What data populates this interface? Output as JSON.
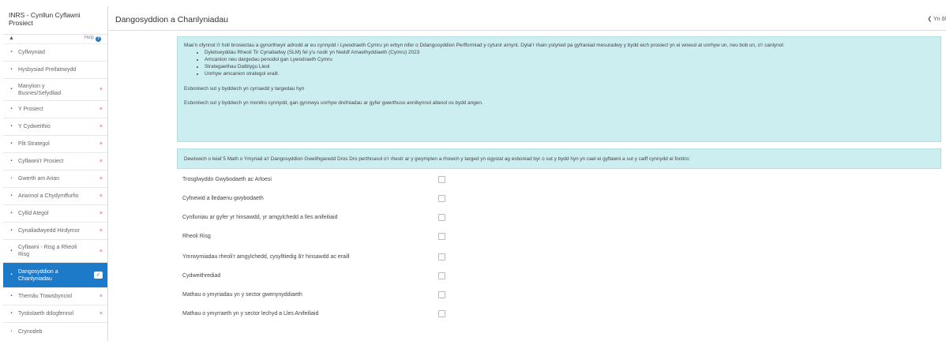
{
  "app": {
    "title_line1": "INRS - Cynllun Cyflawni",
    "title_line2": "Prosiect",
    "person_icon": "person-icon",
    "help_label": "Help"
  },
  "sidebar": {
    "items": [
      {
        "label": "Cyflwyniad",
        "icon": "book-icon",
        "x": false
      },
      {
        "label": "Hysbysiad Preifatrwydd",
        "icon": "book-icon",
        "x": false
      },
      {
        "label_line1": "Manylion y",
        "label_line2": "Busnes/Sefydliad",
        "icon": "book-icon",
        "x": true
      },
      {
        "label": "Y Prosiect",
        "icon": "book-icon",
        "x": true
      },
      {
        "label": "Y Cydweithio",
        "icon": "book-icon",
        "x": true
      },
      {
        "label": "Ffit Strategol",
        "icon": "book-icon",
        "x": true
      },
      {
        "label": "Cyflawni'r Prosiect",
        "icon": "book-icon",
        "x": true
      },
      {
        "label": "Gwerth am Arian",
        "icon": "chevron-right-icon",
        "x": true
      },
      {
        "label": "Ariannol a Chydymffurfio",
        "icon": "book-icon",
        "x": true
      },
      {
        "label": "Cyllid Ategol",
        "icon": "book-icon",
        "x": true
      },
      {
        "label": "Cynaliadwyedd Hirdymor",
        "icon": "book-icon",
        "x": true
      },
      {
        "label_line1": "Cyflawni - Risg a Rheoli",
        "label_line2": "Risg",
        "icon": "book-icon",
        "x": true
      },
      {
        "label_line1": "Dangosyddion a",
        "label_line2": "Chanlyniadau",
        "icon": "book-icon",
        "active": true
      },
      {
        "label": "Themâu Trawsbynciol",
        "icon": "book-icon",
        "x": true
      },
      {
        "label": "Tystiolaeth ddogfennol",
        "icon": "book-icon",
        "x": true
      },
      {
        "label": "Crynodeb",
        "icon": "chevron-right-icon",
        "x": false
      }
    ]
  },
  "header": {
    "title": "Dangosyddion a Chanlyniadau",
    "back_label": "Yn ôl"
  },
  "info": {
    "para1": "Mae'n ofynnol i'r holl brosiectau a gynorthwyir adrodd ar eu cynnydd i Lywodraeth Cymru yn erbyn nifer o Ddangosyddion Perfformiad y cytunir arnynt. Dylai'r rhain ystyried pa gyfraniad mesuradwy y bydd eich prosiect yn ei wneud at unrhyw un, neu bob un, o'r canlynol:",
    "bullets": [
      "Dyletswyddau Rheoli Tir Cynaliadwy (SLM) fel y'u nodir yn Neddf Amaethyddiaeth (Cymru) 2023",
      "Amcanion neu dargedau penodol gan Lywodraeth Cymru",
      "Strategaethau Datblygu Lleol",
      "Unrhyw amcanion strategol eraill."
    ],
    "para2": "Esboniwch sut y byddwch yn cyrraedd y targedau hyn",
    "para3": "Esboniwch sut y byddwch yn monitro cynnydd, gan gynnwys unrhyw drefniadau ar gyfer gwerthuso annibynnol allanol os bydd angen."
  },
  "instruction": "Dewiswch o leiaf 5 Math o Ymyriad a'r Dangosyddion Gweithgaredd Dros Dro perthnasol o'r rhestr ar y gwymplen a rhowch y targed yn ogystal ag esboniad byr o sut y bydd hyn yn cael ei gyflawni a sut y caiff cynnydd ei fonitro:",
  "options": [
    {
      "label": "Trosglwyddo Gwybodaeth ac Arloesi",
      "checked": false
    },
    {
      "label": "Cyfnewid a lledaenu gwybodaeth",
      "checked": false
    },
    {
      "label": "Cynlluniau ar gyfer yr hinsawdd, yr amgylchedd a lles anifeiliaid",
      "checked": false
    },
    {
      "label": "Rheoli Risg",
      "checked": false
    },
    {
      "label": "Ymrwymiadau rheoli'r amgylchedd, cysylltiedig â'r hinsawdd ac eraill",
      "checked": false
    },
    {
      "label": "Cydweithrediad",
      "checked": false
    },
    {
      "label": "Mathau o ymyriadau yn y sector gwenynyddiaeth",
      "checked": false
    },
    {
      "label": "Mathau o ymyrraeth yn y sector lechyd a Lles Anifeiliaid",
      "checked": false
    }
  ],
  "colors": {
    "accent": "#1c7ac9",
    "info_bg": "#cdeef1",
    "error": "#d9534f"
  }
}
